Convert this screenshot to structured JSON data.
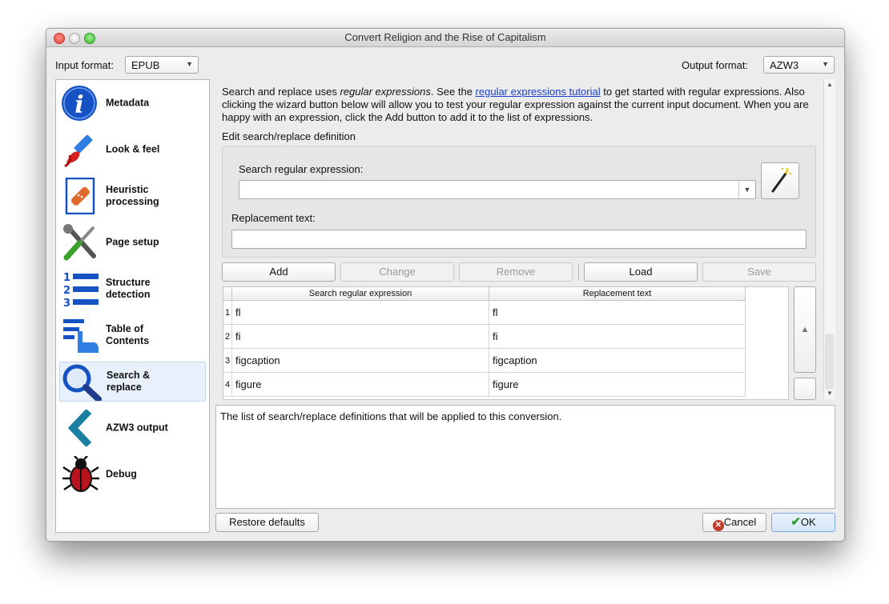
{
  "window": {
    "title": "Convert Religion and the Rise of Capitalism"
  },
  "formats": {
    "input_label": "Input format:",
    "input_value": "EPUB",
    "output_label": "Output format:",
    "output_value": "AZW3"
  },
  "sidebar": {
    "items": [
      {
        "label": "Metadata",
        "icon": "info-icon"
      },
      {
        "label": "Look & feel",
        "icon": "paintbrush-icon"
      },
      {
        "label": "Heuristic\nprocessing",
        "icon": "bandage-document-icon"
      },
      {
        "label": "Page setup",
        "icon": "wrench-screwdriver-icon"
      },
      {
        "label": "Structure\ndetection",
        "icon": "numbered-list-icon"
      },
      {
        "label": "Table of\nContents",
        "icon": "toc-hand-icon"
      },
      {
        "label": "Search &\nreplace",
        "icon": "magnifier-icon",
        "selected": true
      },
      {
        "label": "AZW3 output",
        "icon": "chevron-left-icon"
      },
      {
        "label": "Debug",
        "icon": "bug-icon"
      }
    ]
  },
  "intro": {
    "part1": "Search and replace uses ",
    "italic": "regular expressions",
    "part2": ". See the ",
    "link": "regular expressions tutorial",
    "part3": " to get started with regular expressions. Also clicking the wizard button below will allow you to test your regular expression against the current input document. When you are happy with an expression, click the Add button to add it to the list of expressions."
  },
  "edit_group": {
    "title": "Edit search/replace definition",
    "search_label": "Search regular expression:",
    "search_value": "",
    "replace_label": "Replacement text:",
    "replace_value": ""
  },
  "buttons": {
    "add": "Add",
    "change": "Change",
    "remove": "Remove",
    "load": "Load",
    "save": "Save"
  },
  "table": {
    "headers": [
      "Search regular expression",
      "Replacement text"
    ],
    "rows": [
      {
        "num": "1",
        "search": "fl",
        "replace": "fl"
      },
      {
        "num": "2",
        "search": "fi",
        "replace": "fi"
      },
      {
        "num": "3",
        "search": "figcaption",
        "replace": "figcaption"
      },
      {
        "num": "4",
        "search": "figure",
        "replace": "figure"
      }
    ]
  },
  "help_text": "The list of search/replace definitions that will be applied to this conversion.",
  "footer": {
    "restore": "Restore defaults",
    "cancel": "Cancel",
    "ok": "OK"
  },
  "colors": {
    "accent_blue": "#1552c4",
    "link": "#1a3ecb",
    "cancel_icon": "#c0392b",
    "ok_check": "#2e9e2e"
  }
}
